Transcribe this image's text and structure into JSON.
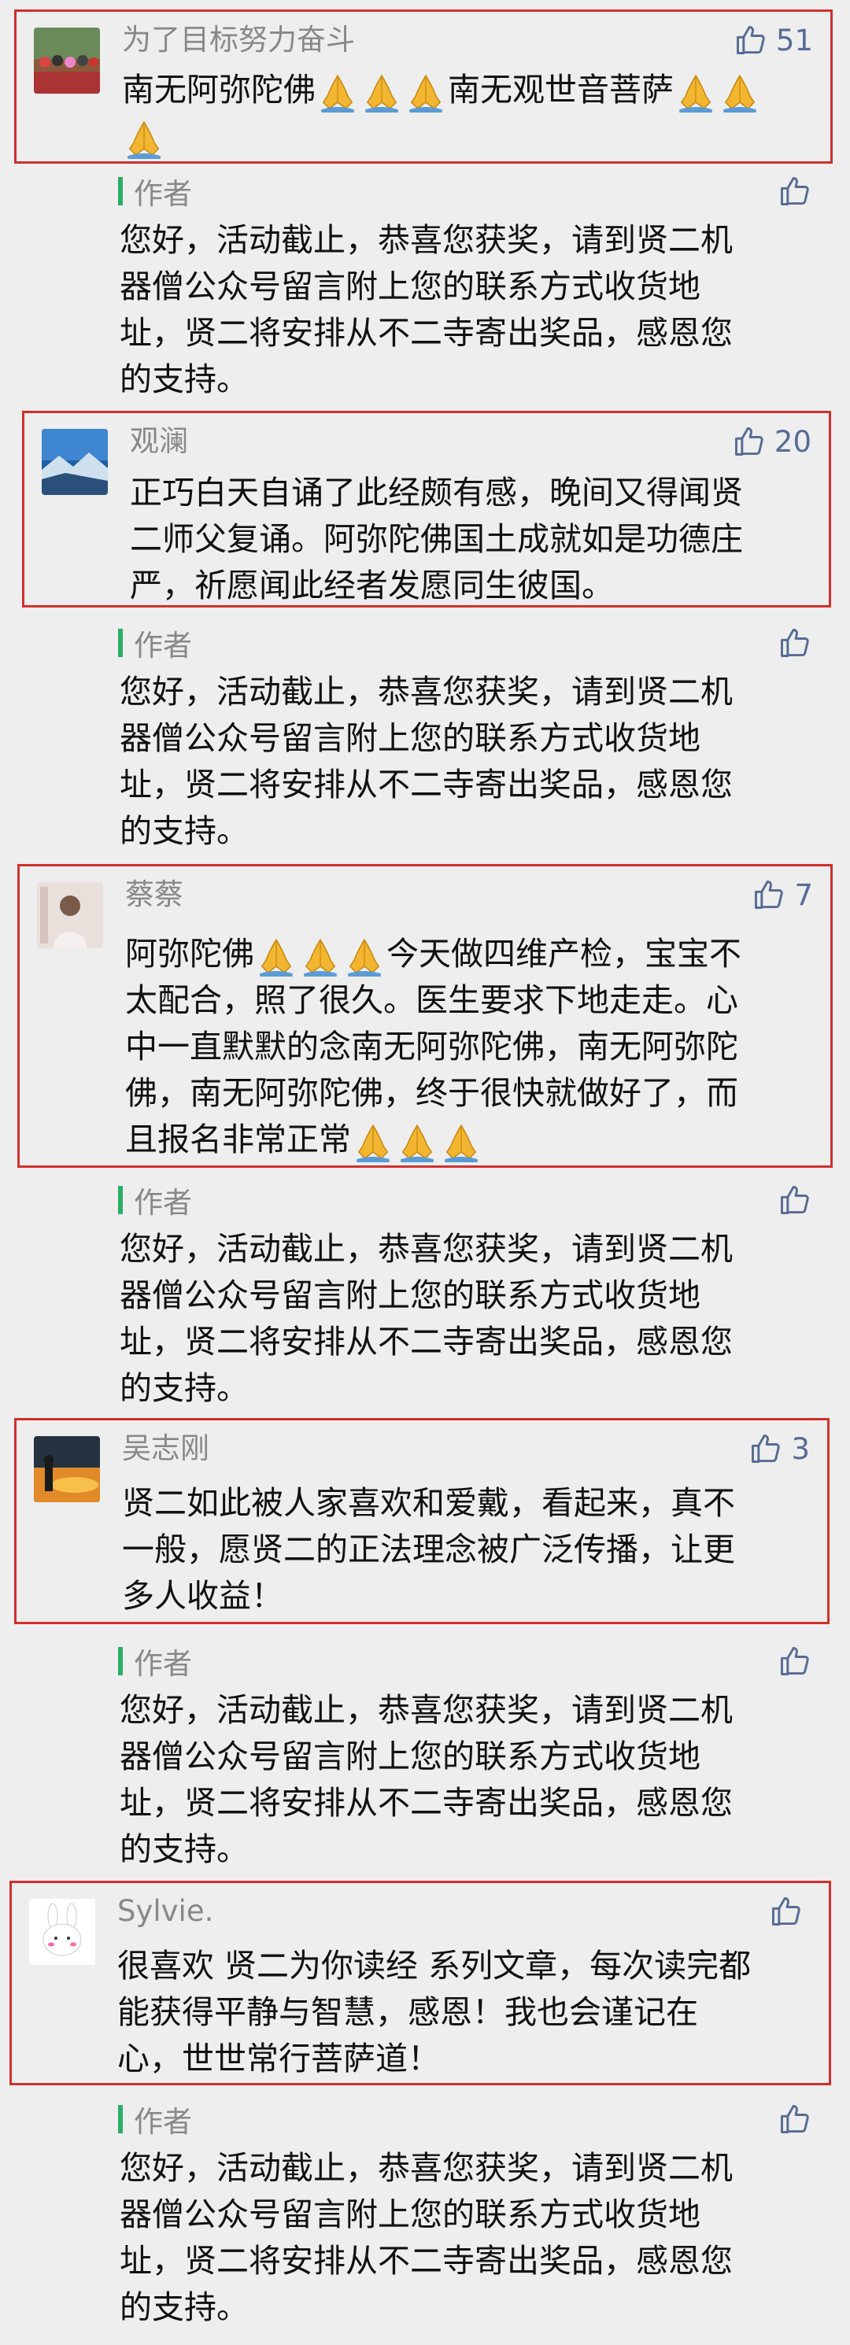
{
  "colors": {
    "highlight_border": "#d0302c",
    "author_bar": "#2aae67",
    "link_blue": "#576b95",
    "muted": "#888888"
  },
  "comments": [
    {
      "avatar": "group-photo-avatar",
      "name": "为了目标努力奋斗",
      "likes": "51",
      "text": "南无阿弥陀佛🙏🙏🙏南无观世音菩萨🙏🙏🙏",
      "reply": {
        "author_label": "作者",
        "text": "您好，活动截止，恭喜您获奖，请到贤二机器僧公众号留言附上您的联系方式收货地址，贤二将安排从不二寺寄出奖品，感恩您的支持。"
      }
    },
    {
      "avatar": "mountain-sky-avatar",
      "name": "观澜",
      "likes": "20",
      "text": "正巧白天自诵了此经颇有感，晚间又得闻贤二师父复诵。阿弥陀佛国土成就如是功德庄严，祈愿闻此经者发愿同生彼国。",
      "reply": {
        "author_label": "作者",
        "text": "您好，活动截止，恭喜您获奖，请到贤二机器僧公众号留言附上您的联系方式收货地址，贤二将安排从不二寺寄出奖品，感恩您的支持。"
      }
    },
    {
      "avatar": "portrait-avatar",
      "name": "蔡蔡",
      "likes": "7",
      "text": "阿弥陀佛🙏🙏🙏今天做四维产检，宝宝不太配合，照了很久。医生要求下地走走。心中一直默默的念南无阿弥陀佛，南无阿弥陀佛，南无阿弥陀佛，终于很快就做好了，而且报名非常正常🙏🙏🙏",
      "reply": {
        "author_label": "作者",
        "text": "您好，活动截止，恭喜您获奖，请到贤二机器僧公众号留言附上您的联系方式收货地址，贤二将安排从不二寺寄出奖品，感恩您的支持。"
      }
    },
    {
      "avatar": "sunset-silhouette-avatar",
      "name": "吴志刚",
      "likes": "3",
      "text": "贤二如此被人家喜欢和爱戴，看起来，真不一般，愿贤二的正法理念被广泛传播，让更多人收益！",
      "reply": {
        "author_label": "作者",
        "text": "您好，活动截止，恭喜您获奖，请到贤二机器僧公众号留言附上您的联系方式收货地址，贤二将安排从不二寺寄出奖品，感恩您的支持。"
      }
    },
    {
      "avatar": "bunny-avatar",
      "name": "Sylvie.",
      "likes": "",
      "text": "很喜欢 贤二为你读经 系列文章，每次读完都能获得平静与智慧，感恩！我也会谨记在心，世世常行菩萨道！",
      "reply": {
        "author_label": "作者",
        "text": "您好，活动截止，恭喜您获奖，请到贤二机器僧公众号留言附上您的联系方式收货地址，贤二将安排从不二寺寄出奖品，感恩您的支持。"
      }
    }
  ]
}
